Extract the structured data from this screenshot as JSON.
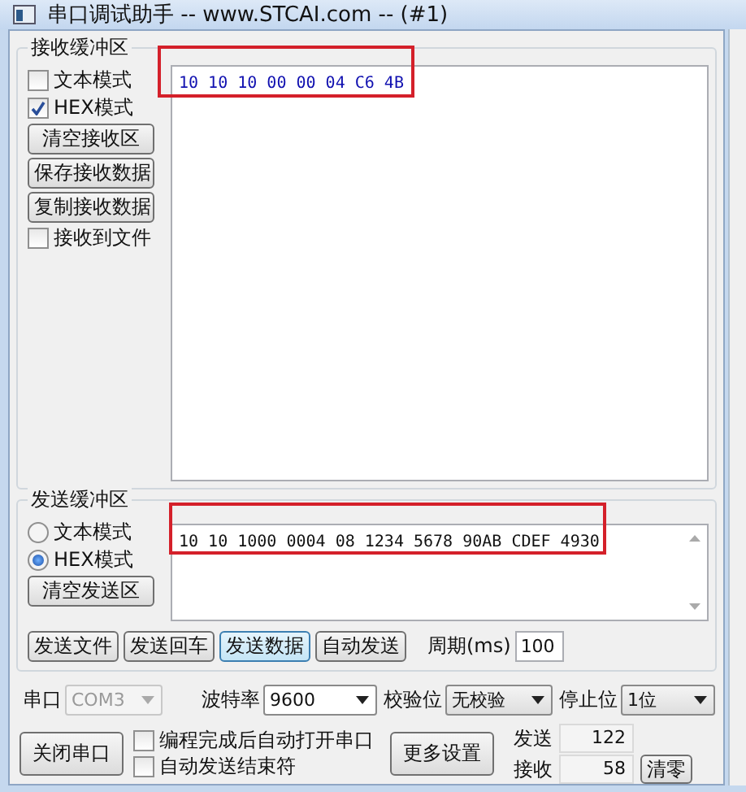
{
  "window": {
    "title": "串口调试助手 -- www.STCAI.com -- (#1)"
  },
  "receive_buffer": {
    "label": "接收缓冲区",
    "modes": [
      {
        "label": "文本模式",
        "checked": false
      },
      {
        "label": "HEX模式",
        "checked": true
      }
    ],
    "buttons": [
      "清空接收区",
      "保存接收数据",
      "复制接收数据"
    ],
    "save_to_file": {
      "label": "接收到文件",
      "checked": false
    },
    "content": "10 10 10 00 00 04 C6 4B",
    "highlighted": true
  },
  "send_buffer": {
    "label": "发送缓冲区",
    "modes": [
      {
        "label": "文本模式",
        "selected": false
      },
      {
        "label": "HEX模式",
        "selected": true
      }
    ],
    "clear_button": "清空发送区",
    "content": "10 10 1000 0004 08 1234 5678 90AB CDEF 4930",
    "highlighted": true
  },
  "send_buttons": [
    {
      "label": "发送文件",
      "focused": false
    },
    {
      "label": "发送回车",
      "focused": false
    },
    {
      "label": "发送数据",
      "focused": true
    },
    {
      "label": "自动发送",
      "focused": false
    }
  ],
  "period": {
    "label": "周期(ms)",
    "value": "100"
  },
  "settings": [
    {
      "label": "串口",
      "value": "COM3",
      "disabled": true
    },
    {
      "label": "波特率",
      "value": "9600",
      "disabled": false
    },
    {
      "label": "校验位",
      "value": "无校验",
      "disabled": false
    },
    {
      "label": "停止位",
      "value": "1位",
      "disabled": false
    }
  ],
  "close_port_button": "关闭串口",
  "options": [
    {
      "label": "编程完成后自动打开串口",
      "checked": false
    },
    {
      "label": "自动发送结束符",
      "checked": false
    }
  ],
  "more_settings_button": "更多设置",
  "counters": [
    {
      "label": "发送",
      "value": "122"
    },
    {
      "label": "接收",
      "value": "58"
    }
  ],
  "clear_counters_button": "清零"
}
